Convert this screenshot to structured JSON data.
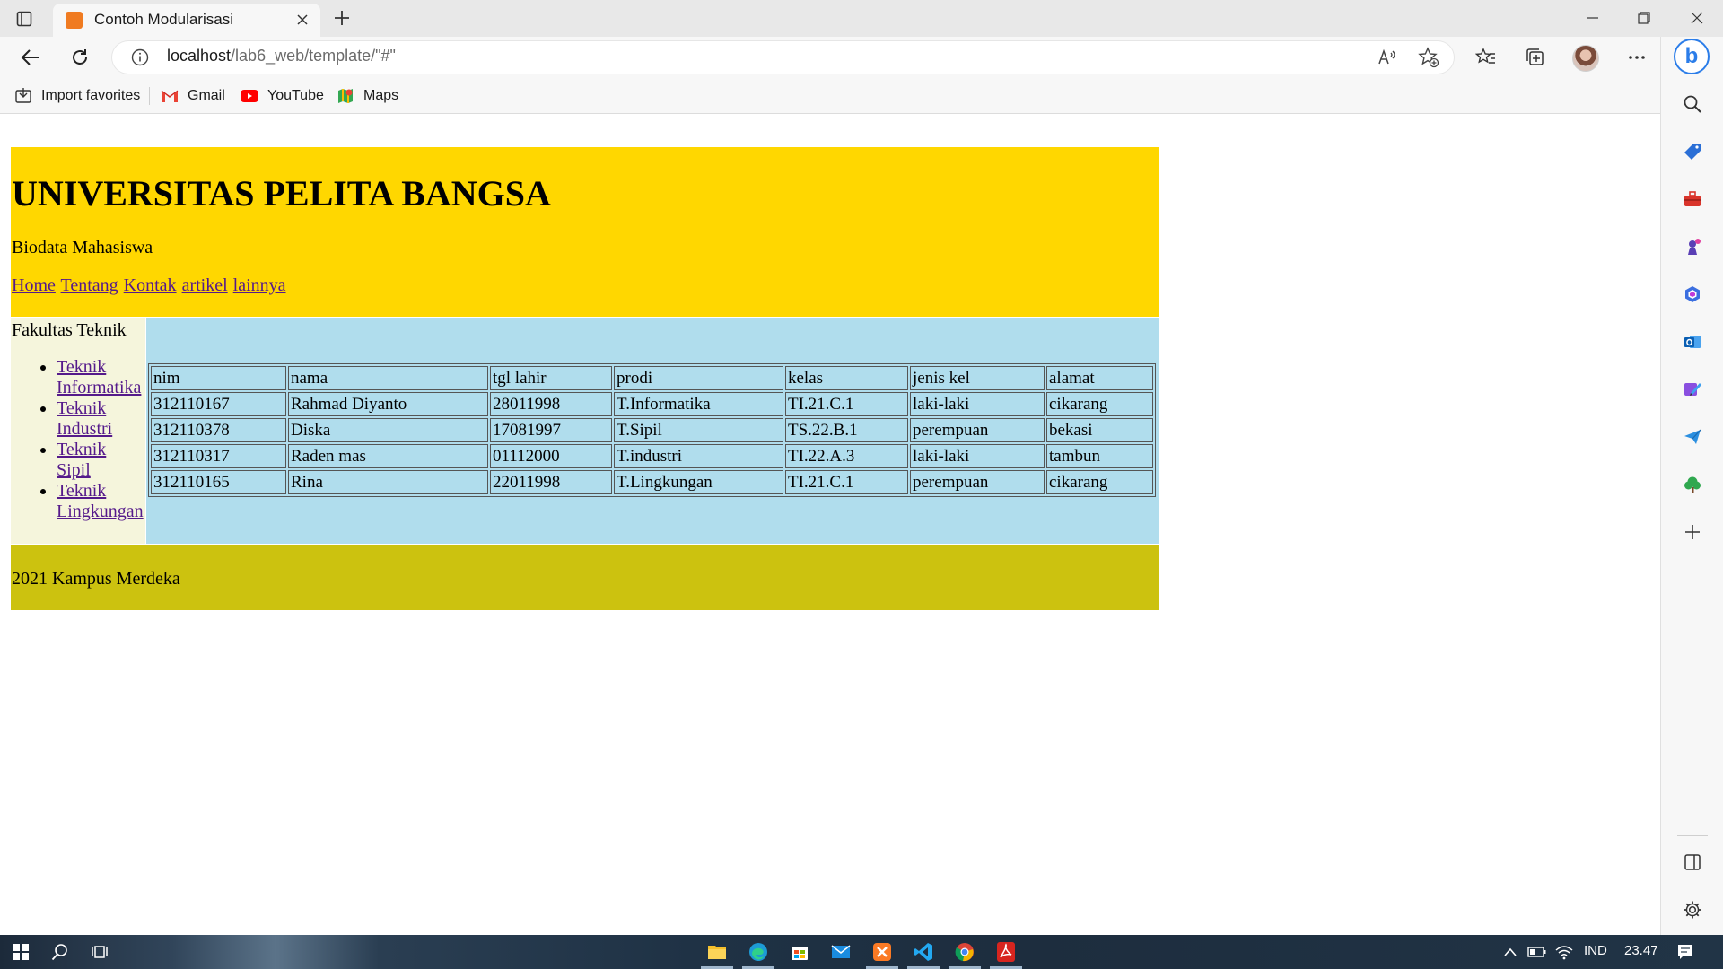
{
  "browser": {
    "tab_title": "Contoh Modularisasi",
    "url_host": "localhost",
    "url_path": "/lab6_web/template/\"#\""
  },
  "favorites": [
    {
      "label": "Import favorites",
      "icon": "import-icon"
    },
    {
      "label": "Gmail",
      "icon": "gmail-icon"
    },
    {
      "label": "YouTube",
      "icon": "youtube-icon"
    },
    {
      "label": "Maps",
      "icon": "maps-icon"
    }
  ],
  "page": {
    "header": {
      "title": "UNIVERSITAS PELITA BANGSA",
      "subtitle": "Biodata Mahasiswa",
      "nav": [
        "Home",
        "Tentang",
        "Kontak",
        "artikel",
        "lainnya"
      ]
    },
    "sidebar": {
      "title": "Fakultas Teknik",
      "links": [
        [
          "Teknik",
          "Informatika"
        ],
        [
          "Teknik",
          "Industri"
        ],
        [
          "Teknik",
          "Sipil"
        ],
        [
          "Teknik",
          "Lingkungan"
        ]
      ]
    },
    "table": {
      "headers": [
        "nim",
        "nama",
        "tgl lahir",
        "prodi",
        "kelas",
        "jenis kel",
        "alamat"
      ],
      "rows": [
        [
          "312110167",
          "Rahmad Diyanto",
          "28011998",
          "T.Informatika",
          "TI.21.C.1",
          "laki-laki",
          "cikarang"
        ],
        [
          "312110378",
          "Diska",
          "17081997",
          "T.Sipil",
          "TS.22.B.1",
          "perempuan",
          "bekasi"
        ],
        [
          "312110317",
          "Raden mas",
          "01112000",
          "T.industri",
          "TI.22.A.3",
          "laki-laki",
          "tambun"
        ],
        [
          "312110165",
          "Rina",
          "22011998",
          "T.Lingkungan",
          "TI.21.C.1",
          "perempuan",
          "cikarang"
        ]
      ]
    },
    "footer": "2021 Kampus Merdeka"
  },
  "colors": {
    "header_bg": "#ffd700",
    "sidebar_bg": "#f5f5dc",
    "main_bg": "#b0dded",
    "footer_bg": "#ccc20f",
    "link": "#551a8b"
  },
  "taskbar": {
    "language": "IND",
    "time": "23.47"
  }
}
